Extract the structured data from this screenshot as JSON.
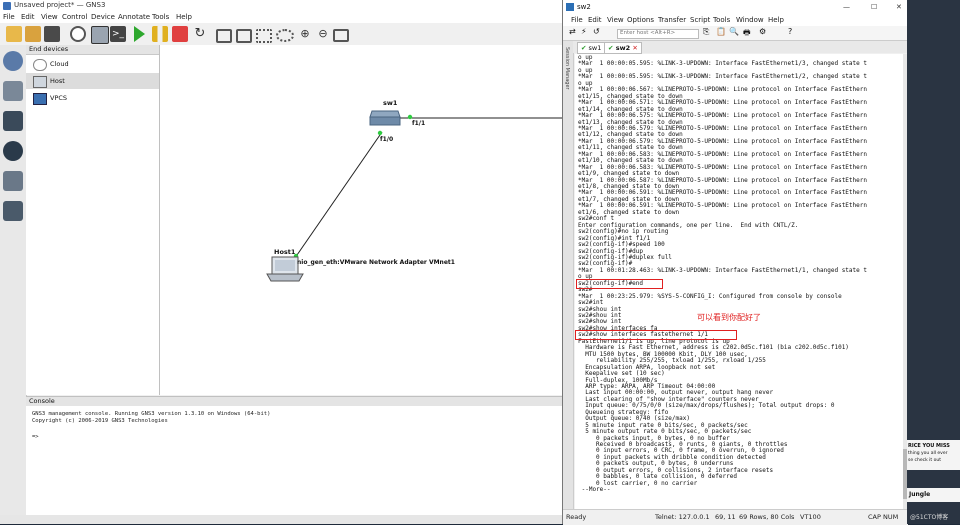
{
  "gns3": {
    "title": "Unsaved project* — GNS3",
    "menu": [
      "File",
      "Edit",
      "View",
      "Control",
      "Device",
      "Annotate",
      "Tools",
      "Help"
    ],
    "devices_panel_title": "End devices",
    "devices": [
      "Cloud",
      "Host",
      "VPCS"
    ],
    "topology": {
      "switch_name": "sw1",
      "switch_port_right": "f1/1",
      "switch_port_down": "f1/0",
      "host_name": "Host1",
      "host_label": "nio_gen_eth:VMware Network Adapter VMnet1"
    },
    "console_title": "Console",
    "console_lines": [
      "GNS3 management console. Running GNS3 version 1.3.10 on Windows (64-bit)",
      "Copyright (c) 2006-2019 GNS3 Technologies",
      "",
      "=>"
    ]
  },
  "crt": {
    "title": "sw2",
    "menu": [
      "File",
      "Edit",
      "View",
      "Options",
      "Transfer",
      "Script",
      "Tools",
      "Window",
      "Help"
    ],
    "host_placeholder": "Enter host <Alt+R>",
    "tabs": [
      "sw1",
      "sw2"
    ],
    "side_label": "Session Manager",
    "annotation": "可以看到你配好了",
    "terminal_lines": [
      "o up",
      "*Mar  1 00:00:05.595: %LINK-3-UPDOWN: Interface FastEthernet1/3, changed state t",
      "o up",
      "*Mar  1 00:00:05.595: %LINK-3-UPDOWN: Interface FastEthernet1/2, changed state t",
      "o up",
      "*Mar  1 00:00:06.567: %LINEPROTO-5-UPDOWN: Line protocol on Interface FastEthern",
      "et1/15, changed state to down",
      "*Mar  1 00:00:06.571: %LINEPROTO-5-UPDOWN: Line protocol on Interface FastEthern",
      "et1/14, changed state to down",
      "*Mar  1 00:00:06.575: %LINEPROTO-5-UPDOWN: Line protocol on Interface FastEthern",
      "et1/13, changed state to down",
      "*Mar  1 00:00:06.579: %LINEPROTO-5-UPDOWN: Line protocol on Interface FastEthern",
      "et1/12, changed state to down",
      "*Mar  1 00:00:06.579: %LINEPROTO-5-UPDOWN: Line protocol on Interface FastEthern",
      "et1/11, changed state to down",
      "*Mar  1 00:00:06.583: %LINEPROTO-5-UPDOWN: Line protocol on Interface FastEthern",
      "et1/10, changed state to down",
      "*Mar  1 00:00:06.583: %LINEPROTO-5-UPDOWN: Line protocol on Interface FastEthern",
      "et1/9, changed state to down",
      "*Mar  1 00:00:06.587: %LINEPROTO-5-UPDOWN: Line protocol on Interface FastEthern",
      "et1/8, changed state to down",
      "*Mar  1 00:00:06.591: %LINEPROTO-5-UPDOWN: Line protocol on Interface FastEthern",
      "et1/7, changed state to down",
      "*Mar  1 00:00:06.591: %LINEPROTO-5-UPDOWN: Line protocol on Interface FastEthern",
      "et1/6, changed state to down",
      "sw2#conf t",
      "Enter configuration commands, one per line.  End with CNTL/Z.",
      "sw2(config)#no ip routing",
      "sw2(config)#int f1/1",
      "sw2(config-if)#speed 100",
      "sw2(config-if)#dup",
      "sw2(config-if)#duplex full",
      "sw2(config-if)#",
      "*Mar  1 00:01:28.463: %LINK-3-UPDOWN: Interface FastEthernet1/1, changed state t",
      "o up",
      "sw2(config-if)#end",
      "sw2#",
      "*Mar  1 00:23:25.979: %SYS-5-CONFIG_I: Configured from console by console",
      "sw2#int",
      "sw2#shou int",
      "sw2#shou int",
      "sw2#show int",
      "sw2#show interfaces fa",
      "sw2#show interfaces fastethernet 1/1",
      "FastEthernet1/1 is up, line protocol is up",
      "  Hardware is Fast Ethernet, address is c202.0d5c.f101 (bia c202.0d5c.f101)",
      "  MTU 1500 bytes, BW 100000 Kbit, DLY 100 usec,",
      "     reliability 255/255, txload 1/255, rxload 1/255",
      "  Encapsulation ARPA, loopback not set",
      "  Keepalive set (10 sec)",
      "  Full-duplex, 100Mb/s",
      "  ARP type: ARPA, ARP Timeout 04:00:00",
      "  Last input 00:00:00, output never, output hang never",
      "  Last clearing of \"show interface\" counters never",
      "  Input queue: 0/75/0/0 (size/max/drops/flushes); Total output drops: 0",
      "  Queueing strategy: fifo",
      "  Output queue: 0/40 (size/max)",
      "  5 minute input rate 0 bits/sec, 0 packets/sec",
      "  5 minute output rate 0 bits/sec, 0 packets/sec",
      "     0 packets input, 0 bytes, 0 no buffer",
      "     Received 0 broadcasts, 0 runts, 0 giants, 0 throttles",
      "     0 input errors, 0 CRC, 0 frame, 0 overrun, 0 ignored",
      "     0 input packets with dribble condition detected",
      "     0 packets output, 0 bytes, 0 underruns",
      "     0 output errors, 0 collisions, 2 interface resets",
      "     0 babbles, 0 late collision, 0 deferred",
      "     0 lost carrier, 0 no carrier",
      " --More--"
    ],
    "status": {
      "ready": "Ready",
      "telnet": "Telnet: 127.0.0.1",
      "pos": "69, 11",
      "size": "69 Rows, 80 Cols",
      "term": "VT100",
      "cap": "CAP NUM"
    }
  },
  "right_strip": {
    "text1": "RICE YOU MISS",
    "text2": "thing you all ever",
    "text3": "se check it out",
    "text4": "Jungle",
    "watermark": "@51CTO博客"
  },
  "colors": {
    "annotation": "#e02020",
    "link": "#222222",
    "port_dot": "#2ecc40"
  }
}
